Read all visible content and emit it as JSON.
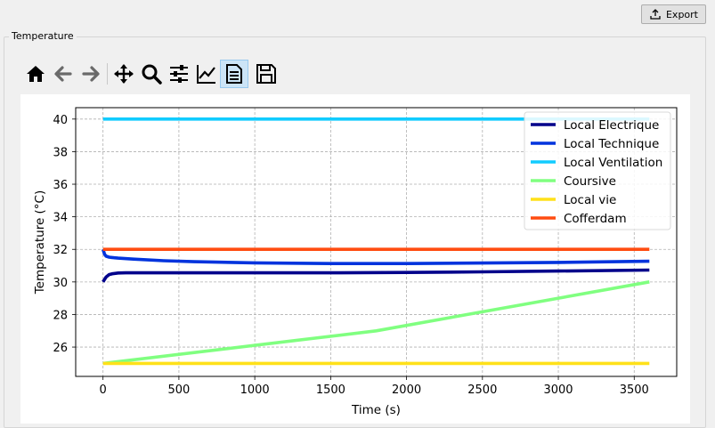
{
  "header": {
    "export_label": "Export",
    "export_icon": "upload-icon"
  },
  "group": {
    "title": "Temperature"
  },
  "toolbar": {
    "buttons": [
      {
        "name": "home-icon"
      },
      {
        "name": "back-arrow-icon"
      },
      {
        "name": "forward-arrow-icon"
      },
      {
        "name": "pan-move-icon"
      },
      {
        "name": "zoom-magnifier-icon"
      },
      {
        "name": "configure-subplots-icon"
      },
      {
        "name": "edit-axis-curve-icon"
      },
      {
        "name": "legend-document-icon",
        "active": true
      },
      {
        "name": "save-floppy-icon"
      }
    ]
  },
  "chart_data": {
    "type": "line",
    "title": "",
    "xlabel": "Time (s)",
    "ylabel": "Temperature (°C)",
    "xlim": [
      -180,
      3780
    ],
    "ylim": [
      24.2,
      40.7
    ],
    "xticks": [
      0,
      500,
      1000,
      1500,
      2000,
      2500,
      3000,
      3500
    ],
    "yticks": [
      26,
      28,
      30,
      32,
      34,
      36,
      38,
      40
    ],
    "grid": true,
    "grid_style": "dashed",
    "legend_position": "upper right",
    "series": [
      {
        "name": "Local Electrique",
        "color": "#00008b",
        "x": [
          0,
          10,
          20,
          40,
          60,
          100,
          150,
          300,
          600,
          1000,
          1500,
          2000,
          2500,
          3000,
          3600
        ],
        "y": [
          30.0,
          30.15,
          30.3,
          30.45,
          30.5,
          30.55,
          30.56,
          30.56,
          30.56,
          30.56,
          30.56,
          30.58,
          30.62,
          30.67,
          30.73
        ]
      },
      {
        "name": "Local Technique",
        "color": "#0033dd",
        "x": [
          0,
          10,
          20,
          40,
          60,
          100,
          200,
          400,
          600,
          1000,
          1500,
          2000,
          2500,
          3000,
          3600
        ],
        "y": [
          32.0,
          31.7,
          31.58,
          31.52,
          31.5,
          31.46,
          31.4,
          31.3,
          31.24,
          31.17,
          31.13,
          31.13,
          31.16,
          31.2,
          31.27
        ]
      },
      {
        "name": "Local Ventilation",
        "color": "#11ccff",
        "x": [
          0,
          3600
        ],
        "y": [
          40.0,
          40.0
        ]
      },
      {
        "name": "Coursive",
        "color": "#80ff80",
        "x": [
          0,
          1800,
          3600
        ],
        "y": [
          25.0,
          27.0,
          30.0
        ]
      },
      {
        "name": "Local vie",
        "color": "#ffe119",
        "x": [
          0,
          3600
        ],
        "y": [
          25.0,
          25.0
        ]
      },
      {
        "name": "Cofferdam",
        "color": "#ff4c11",
        "x": [
          0,
          3600
        ],
        "y": [
          32.0,
          32.0
        ]
      }
    ]
  }
}
